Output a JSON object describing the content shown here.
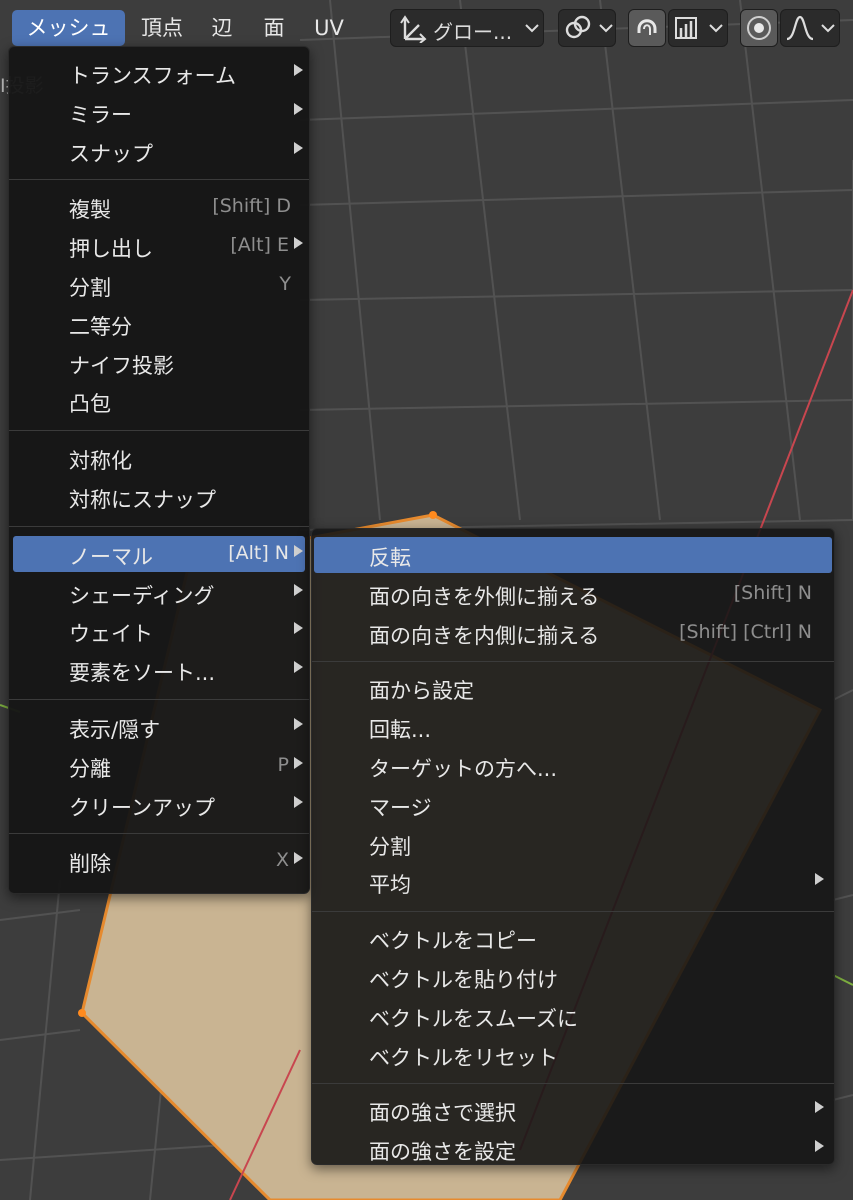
{
  "header": {
    "menus": [
      {
        "label": "メッシュ",
        "active": true
      },
      {
        "label": "頂点",
        "active": false
      },
      {
        "label": "辺",
        "active": false
      },
      {
        "label": "面",
        "active": false
      },
      {
        "label": "UV",
        "active": false
      }
    ],
    "orientation_label": "グロー...",
    "icons": {
      "transform_orientation": "transform-axes-icon",
      "pivot": "link-icon",
      "snap": "magnet-icon",
      "snap_target": "snap-increment-icon",
      "proportional": "proportional-edit-icon",
      "falloff": "falloff-curve-icon"
    }
  },
  "left_edge_text": "I投影",
  "main_menu": {
    "groups": [
      [
        {
          "label": "トランスフォーム",
          "shortcut": "",
          "submenu": true
        },
        {
          "label": "ミラー",
          "shortcut": "",
          "submenu": true
        },
        {
          "label": "スナップ",
          "shortcut": "",
          "submenu": true
        }
      ],
      [
        {
          "label": "複製",
          "shortcut": "[Shift] D",
          "submenu": false
        },
        {
          "label": "押し出し",
          "shortcut": "[Alt] E",
          "submenu": true
        },
        {
          "label": "分割",
          "shortcut": "Y",
          "submenu": false
        },
        {
          "label": "二等分",
          "shortcut": "",
          "submenu": false
        },
        {
          "label": "ナイフ投影",
          "shortcut": "",
          "submenu": false
        },
        {
          "label": "凸包",
          "shortcut": "",
          "submenu": false
        }
      ],
      [
        {
          "label": "対称化",
          "shortcut": "",
          "submenu": false
        },
        {
          "label": "対称にスナップ",
          "shortcut": "",
          "submenu": false
        }
      ],
      [
        {
          "label": "ノーマル",
          "shortcut": "[Alt] N",
          "submenu": true,
          "highlighted": true
        },
        {
          "label": "シェーディング",
          "shortcut": "",
          "submenu": true
        },
        {
          "label": "ウェイト",
          "shortcut": "",
          "submenu": true
        },
        {
          "label": "要素をソート...",
          "shortcut": "",
          "submenu": true
        }
      ],
      [
        {
          "label": "表示/隠す",
          "shortcut": "",
          "submenu": true
        },
        {
          "label": "分離",
          "shortcut": "P",
          "submenu": true
        },
        {
          "label": "クリーンアップ",
          "shortcut": "",
          "submenu": true
        }
      ],
      [
        {
          "label": "削除",
          "shortcut": "X",
          "submenu": true
        }
      ]
    ]
  },
  "normal_submenu": {
    "groups": [
      [
        {
          "label": "反転",
          "shortcut": "",
          "submenu": false,
          "highlighted": true
        },
        {
          "label": "面の向きを外側に揃える",
          "shortcut": "[Shift] N",
          "submenu": false
        },
        {
          "label": "面の向きを内側に揃える",
          "shortcut": "[Shift] [Ctrl] N",
          "submenu": false
        }
      ],
      [
        {
          "label": "面から設定",
          "shortcut": "",
          "submenu": false
        },
        {
          "label": "回転...",
          "shortcut": "",
          "submenu": false
        },
        {
          "label": "ターゲットの方へ...",
          "shortcut": "",
          "submenu": false
        },
        {
          "label": "マージ",
          "shortcut": "",
          "submenu": false
        },
        {
          "label": "分割",
          "shortcut": "",
          "submenu": false
        },
        {
          "label": "平均",
          "shortcut": "",
          "submenu": true
        }
      ],
      [
        {
          "label": "ベクトルをコピー",
          "shortcut": "",
          "submenu": false
        },
        {
          "label": "ベクトルを貼り付け",
          "shortcut": "",
          "submenu": false
        },
        {
          "label": "ベクトルをスムーズに",
          "shortcut": "",
          "submenu": false
        },
        {
          "label": "ベクトルをリセット",
          "shortcut": "",
          "submenu": false
        }
      ],
      [
        {
          "label": "面の強さで選択",
          "shortcut": "",
          "submenu": true
        },
        {
          "label": "面の強さを設定",
          "shortcut": "",
          "submenu": true
        }
      ]
    ]
  },
  "colors": {
    "highlight": "#4d73b3",
    "menu_bg": "#161616",
    "viewport_bg": "#3b3b3b",
    "mesh_face": "#c9b492",
    "mesh_edge": "#e68a2e",
    "x_axis": "#c8464f",
    "y_axis": "#7eb040"
  }
}
